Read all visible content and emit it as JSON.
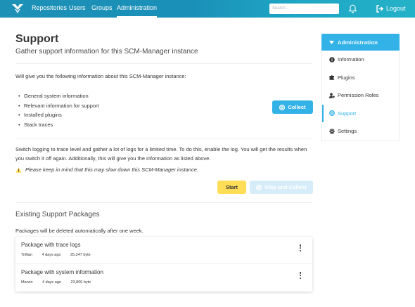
{
  "topbar": {
    "nav": [
      {
        "label": "Repositories",
        "active": false
      },
      {
        "label": "Users",
        "active": false
      },
      {
        "label": "Groups",
        "active": false
      },
      {
        "label": "Administration",
        "active": true
      }
    ],
    "search_placeholder": "Search...",
    "logout_label": "Logout",
    "icons": {
      "logo": "scm-manager-logo-icon",
      "bell": "bell-icon",
      "logout": "sign-out-icon"
    }
  },
  "page": {
    "title": "Support",
    "subtitle": "Gather support information for this SCM-Manager instance",
    "intro": "Will give you the following information about this SCM-Manager instance:",
    "info_items": [
      "General system information",
      "Relevant information for support",
      "Installed plugins",
      "Stack traces"
    ],
    "collect_label": "Collect",
    "trace_text": "Switch logging to trace level and gather a lot of logs for a limited time. To do this, enable the log. You will get the results when you switch it off again. Additionally, this will give you the information as listed above.",
    "warning": "Please keep in mind that this may slow down this SCM-Manager instance.",
    "start_label": "Start",
    "stop_label": "Stop and Collect",
    "section_title": "Existing Support Packages",
    "delete_note": "Packages will be deleted automatically after one week.",
    "packages": [
      {
        "title": "Package with trace logs",
        "user": "Trillian",
        "age": "4 days ago",
        "size": "25,247 byte"
      },
      {
        "title": "Package with system information",
        "user": "Marvin",
        "age": "4 days ago",
        "size": "23,800 byte"
      }
    ]
  },
  "sidebar": {
    "header": "Administration",
    "items": [
      {
        "label": "Information",
        "icon": "info-circle-icon",
        "active": false
      },
      {
        "label": "Plugins",
        "icon": "puzzle-piece-icon",
        "active": false
      },
      {
        "label": "Permission Roles",
        "icon": "user-shield-icon",
        "active": false
      },
      {
        "label": "Support",
        "icon": "life-ring-icon",
        "active": true
      },
      {
        "label": "Settings",
        "icon": "cog-icon",
        "active": false
      }
    ]
  },
  "colors": {
    "primary": "#33b2e8",
    "topbar": "#1d91b6",
    "warning": "#ffdd57",
    "text": "#363636"
  }
}
